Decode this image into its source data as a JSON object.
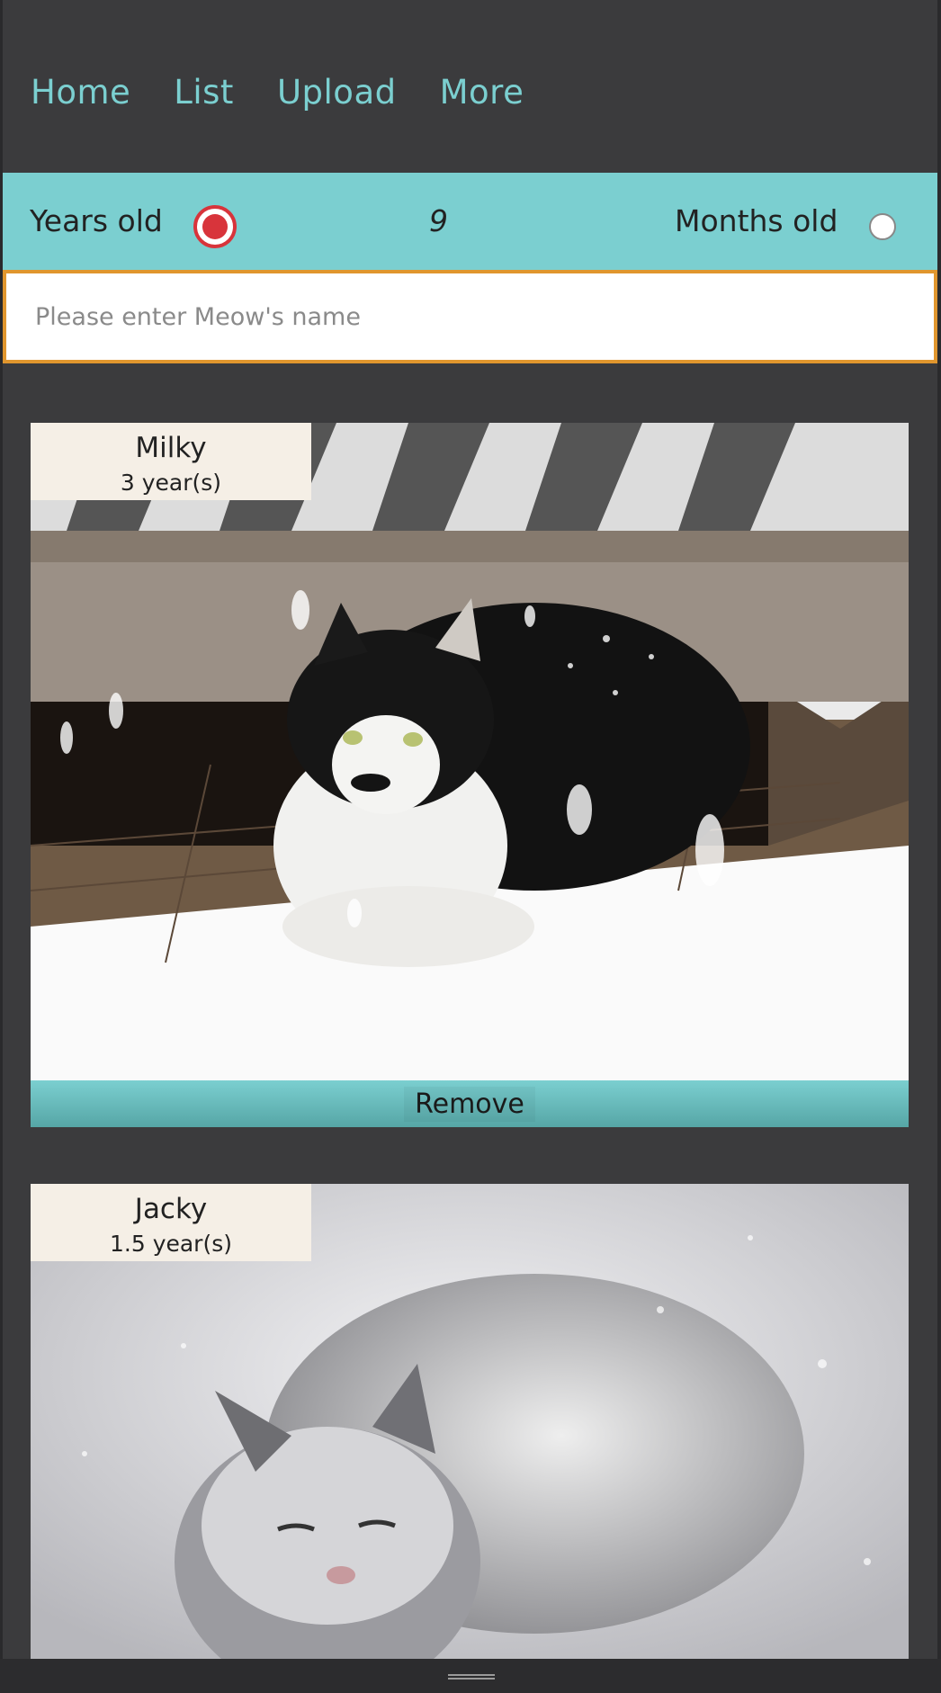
{
  "nav": {
    "home": "Home",
    "list": "List",
    "upload": "Upload",
    "more": "More"
  },
  "age_filter": {
    "years_label": "Years old",
    "months_label": "Months old",
    "selected": "years",
    "value": "9"
  },
  "name_input": {
    "placeholder": "Please enter Meow's name",
    "value": ""
  },
  "cats": [
    {
      "name": "Milky",
      "age": "3 year(s)",
      "remove_label": "Remove"
    },
    {
      "name": "Jacky",
      "age": "1.5 year(s)"
    }
  ],
  "colors": {
    "accent": "#7bcfd0",
    "background": "#3b3b3d",
    "selected_radio": "#d8343b",
    "input_border": "#e0962e",
    "name_tag_bg": "#f5efe6"
  }
}
